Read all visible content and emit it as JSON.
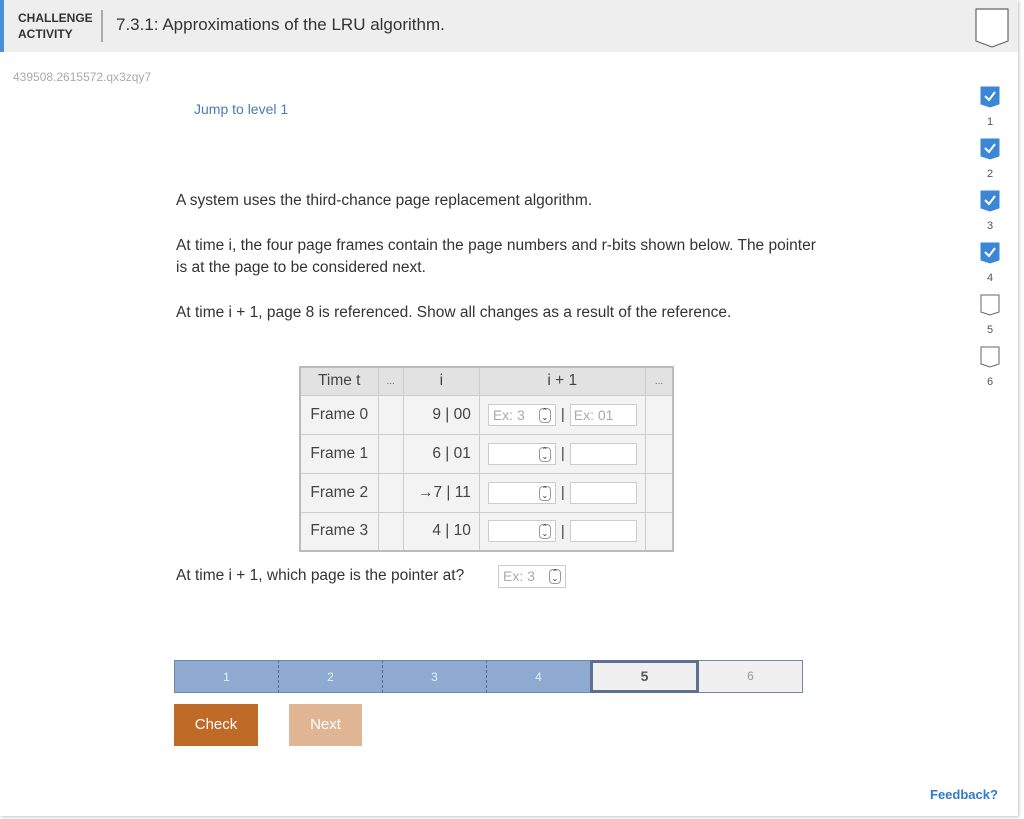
{
  "header": {
    "label_line1": "CHALLENGE",
    "label_line2": "ACTIVITY",
    "title": "7.3.1: Approximations of the LRU algorithm."
  },
  "activity_code": "439508.2615572.qx3zqy7",
  "jump_link": "Jump to level 1",
  "instructions": {
    "p1": "A system uses the third-chance page replacement algorithm.",
    "p2": "At time i, the four page frames contain the page numbers and r-bits shown below. The pointer is at the page to be considered next.",
    "p3": "At time i + 1, page 8 is referenced. Show all changes as a result of the reference."
  },
  "table": {
    "headers": [
      "Time t",
      "...",
      "i",
      "i + 1",
      "..."
    ],
    "rows": [
      {
        "frame": "Frame 0",
        "value_i": "9 | 00",
        "page_placeholder": "Ex: 3",
        "bits_placeholder": "Ex: 01"
      },
      {
        "frame": "Frame 1",
        "value_i": "6 | 01",
        "page_placeholder": "",
        "bits_placeholder": ""
      },
      {
        "frame": "Frame 2",
        "value_i": "→7 | 11",
        "page_placeholder": "",
        "bits_placeholder": ""
      },
      {
        "frame": "Frame 3",
        "value_i": "4 | 10",
        "page_placeholder": "",
        "bits_placeholder": ""
      }
    ],
    "separator": "|"
  },
  "question2": {
    "text": "At time i + 1, which page is the pointer at?",
    "placeholder": "Ex: 3"
  },
  "progress": {
    "levels": [
      "1",
      "2",
      "3",
      "4",
      "5",
      "6"
    ],
    "completed": 4,
    "current": 5
  },
  "side_levels": [
    {
      "num": "1",
      "done": true
    },
    {
      "num": "2",
      "done": true
    },
    {
      "num": "3",
      "done": true
    },
    {
      "num": "4",
      "done": true
    },
    {
      "num": "5",
      "done": false
    },
    {
      "num": "6",
      "done": false
    }
  ],
  "buttons": {
    "check": "Check",
    "next": "Next"
  },
  "feedback": "Feedback?",
  "colors": {
    "accent": "#4a90d9",
    "check": "#c06a28",
    "next_disabled": "#e0b594",
    "progress_done": "#8eaad0",
    "link": "#2f7bc9"
  }
}
